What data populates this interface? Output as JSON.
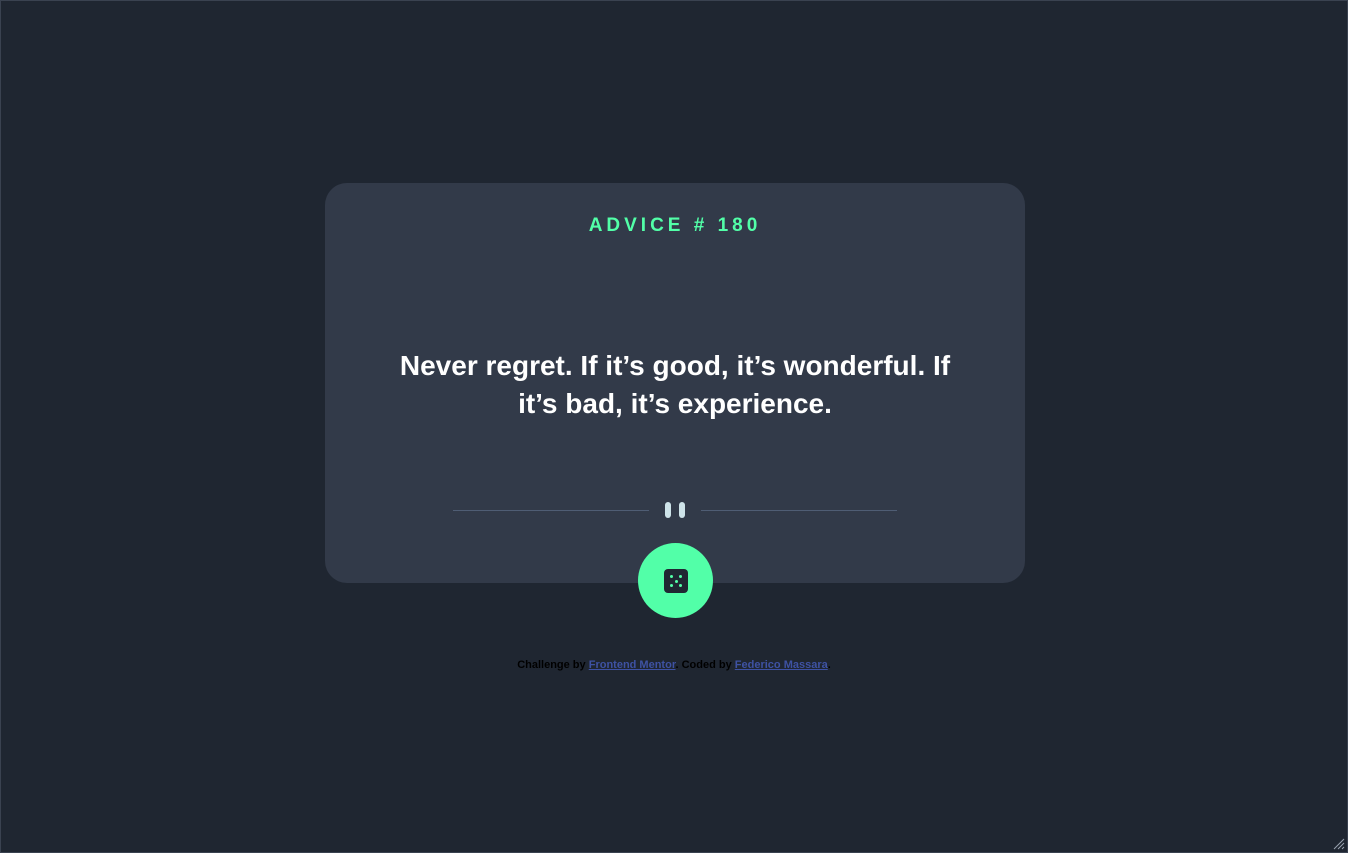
{
  "advice": {
    "id_label": "ADVICE # 180",
    "text": "Never regret. If it’s good, it’s wonderful. If it’s bad, it’s experience."
  },
  "footer": {
    "challenge_prefix": "Challenge by",
    "challenge_link": "Frontend Mentor",
    "separator": ". Coded by",
    "coder_link": "Federico Massara",
    "suffix": "."
  },
  "colors": {
    "background": "#1f2631",
    "card": "#323a49",
    "accent": "#52ffa8",
    "text": "#ffffff",
    "link": "#3e52a3"
  },
  "icons": {
    "divider": "pause-icon",
    "button": "dice-icon"
  }
}
